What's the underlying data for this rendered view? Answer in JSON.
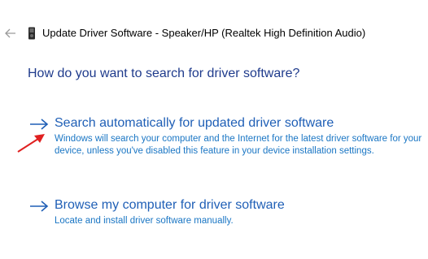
{
  "titlebar": {
    "back_icon": "back-arrow-icon",
    "device_icon": "speaker-device-icon",
    "title": "Update Driver Software - Speaker/HP (Realtek High Definition Audio)"
  },
  "main": {
    "heading": "How do you want to search for driver software?",
    "options": [
      {
        "title": "Search automatically for updated driver software",
        "description": "Windows will search your computer and the Internet for the latest driver software for your device, unless you've disabled this feature in your device installation settings."
      },
      {
        "title": "Browse my computer for driver software",
        "description": "Locate and install driver software manually."
      }
    ]
  },
  "colors": {
    "heading": "#1f3b8c",
    "link": "#1f5fb6",
    "description": "#1a76c4",
    "annotation": "#e02020"
  }
}
